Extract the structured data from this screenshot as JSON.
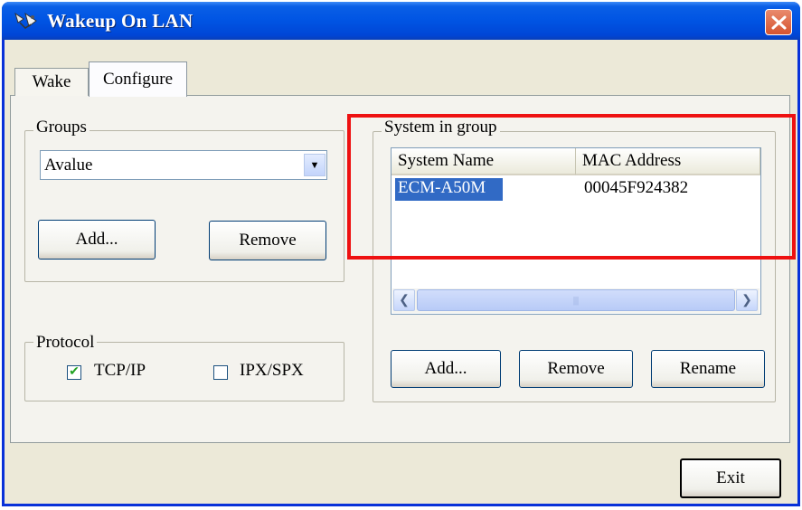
{
  "window": {
    "title": "Wakeup On LAN"
  },
  "tabs": [
    {
      "label": "Wake"
    },
    {
      "label": "Configure"
    }
  ],
  "groups": {
    "legend": "Groups",
    "selected": "Avalue",
    "add_label": "Add...",
    "remove_label": "Remove"
  },
  "protocol": {
    "legend": "Protocol",
    "options": [
      {
        "label": "TCP/IP",
        "checked": true
      },
      {
        "label": "IPX/SPX",
        "checked": false
      }
    ]
  },
  "system_in_group": {
    "legend": "System in group",
    "columns": [
      "System Name",
      "MAC Address"
    ],
    "rows": [
      {
        "name": "ECM-A50M",
        "mac": "00045F924382",
        "selected": true
      }
    ],
    "add_label": "Add...",
    "remove_label": "Remove",
    "rename_label": "Rename"
  },
  "exit_label": "Exit",
  "colors": {
    "titlebar": "#0054e3",
    "selection": "#316ac5",
    "highlight": "#ee1111",
    "close": "#d5542f"
  },
  "icons": {
    "app": "network-icon",
    "close": "close-icon",
    "dropdown": "chevron-down-icon",
    "check": "checkmark-icon"
  }
}
